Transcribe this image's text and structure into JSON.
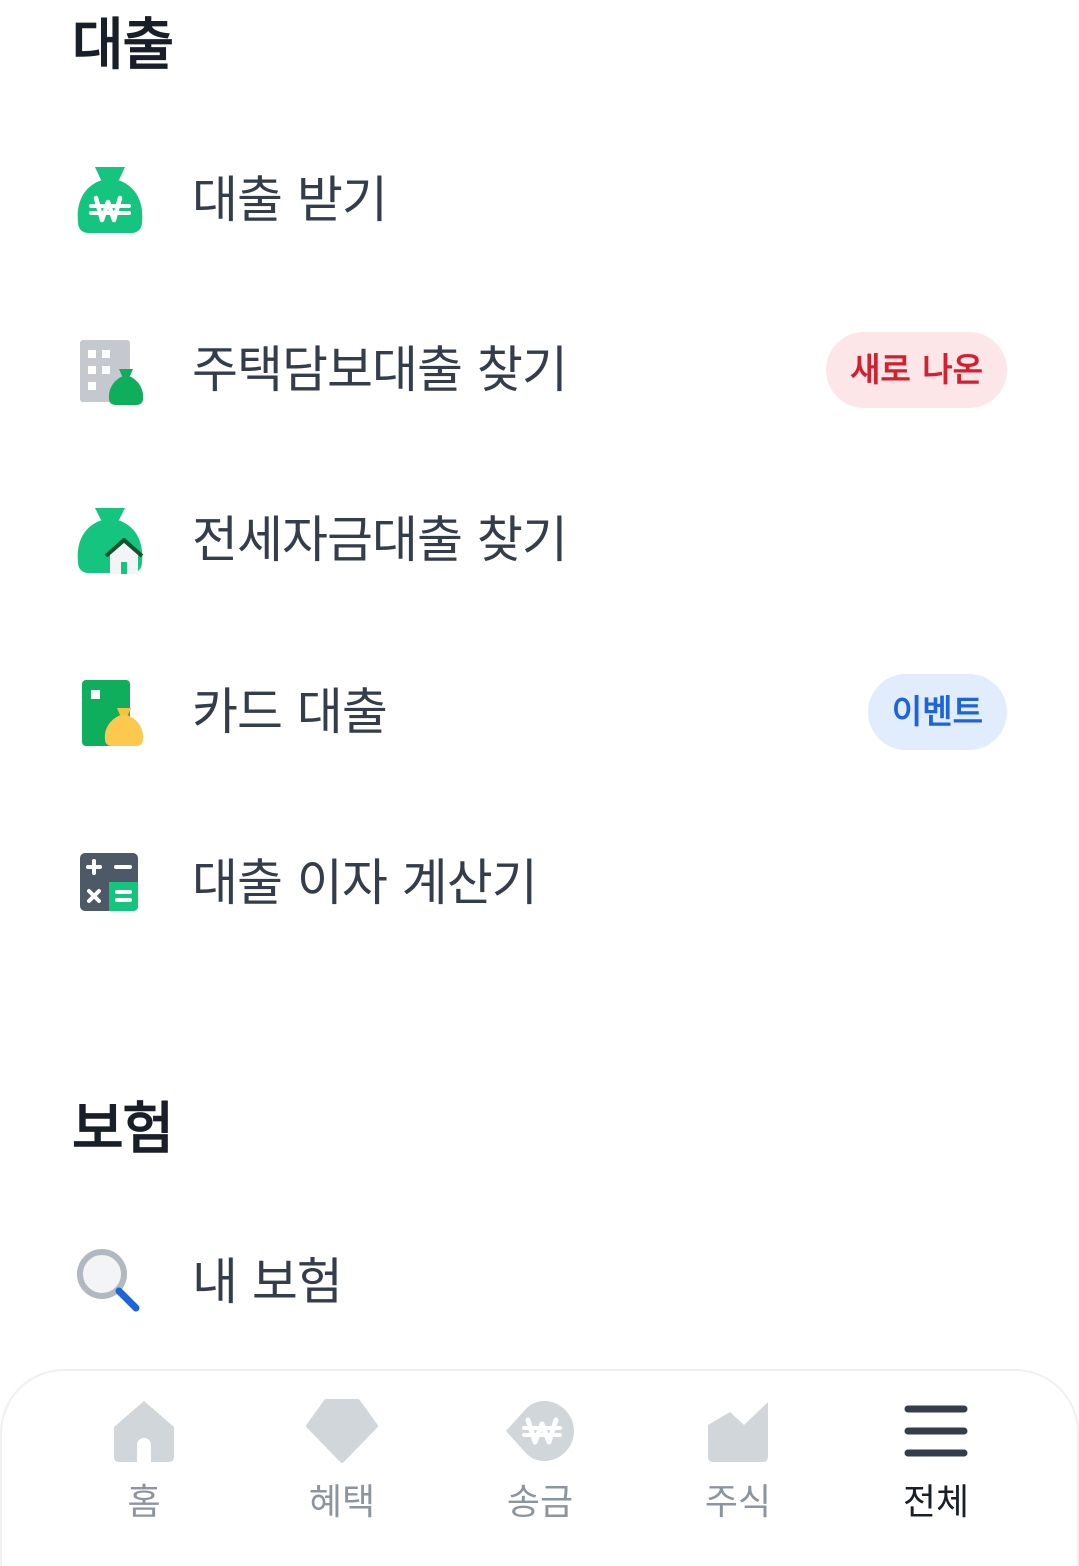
{
  "loan_section": {
    "title": "대출",
    "items": [
      {
        "label": "대출 받기",
        "icon": "money-bag-won-icon",
        "badge": ""
      },
      {
        "label": "주택담보대출 찾기",
        "icon": "building-money-bag-icon",
        "badge": "새로 나온"
      },
      {
        "label": "전세자금대출 찾기",
        "icon": "money-bag-house-icon",
        "badge": ""
      },
      {
        "label": "카드 대출",
        "icon": "card-money-bag-icon",
        "badge": "이벤트"
      },
      {
        "label": "대출 이자 계산기",
        "icon": "calculator-icon",
        "badge": ""
      }
    ]
  },
  "insurance_section": {
    "title": "보험",
    "items": [
      {
        "label": "내 보험",
        "icon": "magnifier-icon"
      }
    ]
  },
  "tab_bar": {
    "tabs": [
      {
        "label": "홈",
        "icon": "home-icon",
        "active": false
      },
      {
        "label": "혜택",
        "icon": "gem-icon",
        "active": false
      },
      {
        "label": "송금",
        "icon": "transfer-won-icon",
        "active": false
      },
      {
        "label": "주식",
        "icon": "stock-chart-icon",
        "active": false
      },
      {
        "label": "전체",
        "icon": "menu-icon",
        "active": true
      }
    ]
  },
  "colors": {
    "green": "#15c47e",
    "dark_green": "#0fae5c",
    "gray_icon": "#c5c9cf",
    "badge_new_bg": "#fde6e8",
    "badge_new_text": "#d22030",
    "badge_event_bg": "#e1ecfd",
    "badge_event_text": "#1b64da",
    "tab_inactive": "#d1d6db",
    "tab_active": "#333d4b"
  }
}
